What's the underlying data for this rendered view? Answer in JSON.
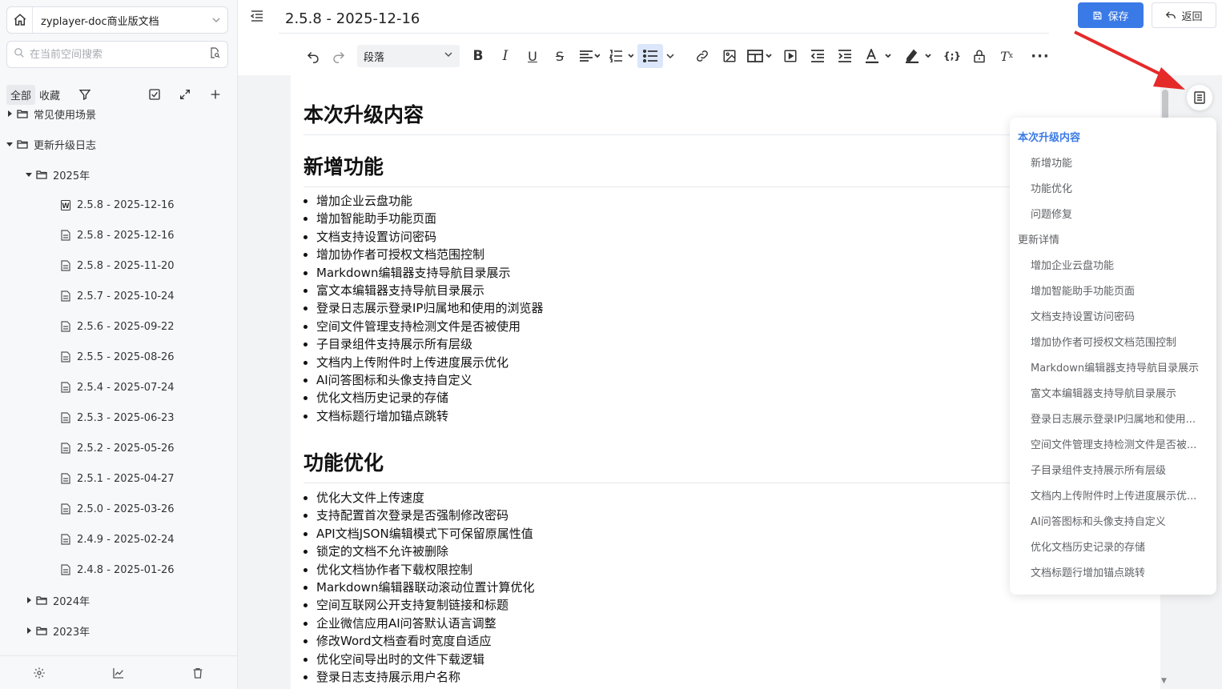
{
  "space": {
    "name": "zyplayer-doc商业版文档"
  },
  "search": {
    "placeholder": "在当前空间搜索"
  },
  "filter": {
    "tabs": [
      "全部",
      "收藏"
    ]
  },
  "tree": [
    {
      "label": "常见使用场景",
      "level": 0,
      "type": "folder",
      "expanded": false
    },
    {
      "label": "更新升级日志",
      "level": 0,
      "type": "folder",
      "expanded": true
    },
    {
      "label": "2025年",
      "level": 1,
      "type": "folder",
      "expanded": true
    },
    {
      "label": "2.5.8 - 2025-12-16",
      "level": 2,
      "type": "word",
      "selected": true
    },
    {
      "label": "2.5.8 - 2025-12-16",
      "level": 2,
      "type": "doc"
    },
    {
      "label": "2.5.8 - 2025-11-20",
      "level": 2,
      "type": "doc"
    },
    {
      "label": "2.5.7 - 2025-10-24",
      "level": 2,
      "type": "doc"
    },
    {
      "label": "2.5.6 - 2025-09-22",
      "level": 2,
      "type": "doc"
    },
    {
      "label": "2.5.5 - 2025-08-26",
      "level": 2,
      "type": "doc"
    },
    {
      "label": "2.5.4 - 2025-07-24",
      "level": 2,
      "type": "doc"
    },
    {
      "label": "2.5.3 - 2025-06-23",
      "level": 2,
      "type": "doc"
    },
    {
      "label": "2.5.2 - 2025-05-26",
      "level": 2,
      "type": "doc"
    },
    {
      "label": "2.5.1 - 2025-04-27",
      "level": 2,
      "type": "doc"
    },
    {
      "label": "2.5.0 - 2025-03-26",
      "level": 2,
      "type": "doc"
    },
    {
      "label": "2.4.9 - 2025-02-24",
      "level": 2,
      "type": "doc"
    },
    {
      "label": "2.4.8 - 2025-01-26",
      "level": 2,
      "type": "doc"
    },
    {
      "label": "2024年",
      "level": 1,
      "type": "folder",
      "expanded": false
    },
    {
      "label": "2023年",
      "level": 1,
      "type": "folder",
      "expanded": false
    }
  ],
  "document": {
    "title": "2.5.8 - 2025-12-16"
  },
  "buttons": {
    "save": "保存",
    "back": "返回"
  },
  "toolbar": {
    "paragraph": "段落"
  },
  "content": {
    "h1_main": "本次升级内容",
    "h1_new": "新增功能",
    "new_features": [
      "增加企业云盘功能",
      "增加智能助手功能页面",
      "文档支持设置访问密码",
      "增加协作者可授权文档范围控制",
      "Markdown编辑器支持导航目录展示",
      "富文本编辑器支持导航目录展示",
      "登录日志展示登录IP归属地和使用的浏览器",
      "空间文件管理支持检测文件是否被使用",
      "子目录组件支持展示所有层级",
      "文档内上传附件时上传进度展示优化",
      "AI问答图标和头像支持自定义",
      "优化文档历史记录的存储",
      "文档标题行增加锚点跳转"
    ],
    "h1_opt": "功能优化",
    "optimizations": [
      "优化大文件上传速度",
      "支持配置首次登录是否强制修改密码",
      "API文档JSON编辑模式下可保留原属性值",
      "锁定的文档不允许被删除",
      "优化文档协作者下载权限控制",
      "Markdown编辑器联动滚动位置计算优化",
      "空间互联网公开支持复制链接和标题",
      "企业微信应用AI问答默认语言调整",
      "修改Word文档查看时宽度自适应",
      "优化空间导出时的文件下载逻辑",
      "登录日志支持展示用户名称"
    ]
  },
  "toc": [
    {
      "label": "本次升级内容",
      "level": 1,
      "active": true
    },
    {
      "label": "新增功能",
      "level": 2
    },
    {
      "label": "功能优化",
      "level": 2
    },
    {
      "label": "问题修复",
      "level": 2
    },
    {
      "label": "更新详情",
      "level": 1
    },
    {
      "label": "增加企业云盘功能",
      "level": 2
    },
    {
      "label": "增加智能助手功能页面",
      "level": 2
    },
    {
      "label": "文档支持设置访问密码",
      "level": 2
    },
    {
      "label": "增加协作者可授权文档范围控制",
      "level": 2
    },
    {
      "label": "Markdown编辑器支持导航目录展示",
      "level": 2
    },
    {
      "label": "富文本编辑器支持导航目录展示",
      "level": 2
    },
    {
      "label": "登录日志展示登录IP归属地和使用...",
      "level": 2
    },
    {
      "label": "空间文件管理支持检测文件是否被...",
      "level": 2
    },
    {
      "label": "子目录组件支持展示所有层级",
      "level": 2
    },
    {
      "label": "文档内上传附件时上传进度展示优...",
      "level": 2
    },
    {
      "label": "AI问答图标和头像支持自定义",
      "level": 2
    },
    {
      "label": "优化文档历史记录的存储",
      "level": 2
    },
    {
      "label": "文档标题行增加锚点跳转",
      "level": 2
    }
  ],
  "colors": {
    "accent": "#3a7ae6",
    "annotation_arrow": "#e52a2a"
  }
}
